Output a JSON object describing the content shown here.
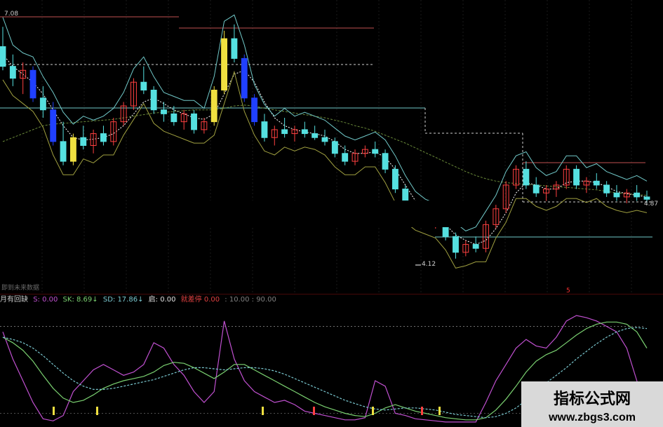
{
  "chart_data": [
    {
      "type": "candlestick",
      "title": "",
      "price_labels": {
        "high": "7.08",
        "low": "4.12",
        "last": "4.87"
      },
      "ylim": [
        3.8,
        7.3
      ],
      "candles": [
        [
          6.8,
          7.05,
          6.5,
          6.55
        ],
        [
          6.55,
          6.7,
          6.3,
          6.4
        ],
        [
          6.4,
          6.6,
          6.2,
          6.5
        ],
        [
          6.5,
          6.55,
          6.1,
          6.15
        ],
        [
          6.15,
          6.3,
          5.9,
          6.0
        ],
        [
          6.0,
          6.1,
          5.55,
          5.6
        ],
        [
          5.6,
          5.85,
          5.3,
          5.35
        ],
        [
          5.35,
          5.7,
          5.3,
          5.65
        ],
        [
          5.65,
          5.8,
          5.5,
          5.55
        ],
        [
          5.55,
          5.75,
          5.45,
          5.7
        ],
        [
          5.7,
          5.8,
          5.55,
          5.6
        ],
        [
          5.6,
          5.9,
          5.55,
          5.85
        ],
        [
          5.85,
          6.1,
          5.8,
          6.05
        ],
        [
          6.05,
          6.4,
          6.0,
          6.35
        ],
        [
          6.35,
          6.55,
          6.2,
          6.25
        ],
        [
          6.25,
          6.3,
          5.95,
          6.0
        ],
        [
          6.0,
          6.1,
          5.85,
          5.95
        ],
        [
          5.95,
          6.05,
          5.8,
          5.85
        ],
        [
          5.85,
          6.0,
          5.75,
          5.95
        ],
        [
          5.95,
          6.0,
          5.7,
          5.75
        ],
        [
          5.75,
          5.9,
          5.7,
          5.85
        ],
        [
          5.85,
          6.3,
          5.8,
          6.25
        ],
        [
          6.25,
          7.0,
          6.2,
          6.9
        ],
        [
          6.9,
          7.08,
          6.6,
          6.65
        ],
        [
          6.65,
          6.7,
          6.1,
          6.15
        ],
        [
          6.15,
          6.2,
          5.8,
          5.85
        ],
        [
          5.85,
          5.95,
          5.6,
          5.65
        ],
        [
          5.65,
          5.8,
          5.55,
          5.75
        ],
        [
          5.75,
          5.9,
          5.65,
          5.7
        ],
        [
          5.7,
          5.8,
          5.6,
          5.75
        ],
        [
          5.75,
          5.85,
          5.65,
          5.7
        ],
        [
          5.7,
          5.8,
          5.62,
          5.65
        ],
        [
          5.65,
          5.75,
          5.55,
          5.6
        ],
        [
          5.6,
          5.65,
          5.4,
          5.45
        ],
        [
          5.45,
          5.55,
          5.3,
          5.35
        ],
        [
          5.35,
          5.5,
          5.3,
          5.45
        ],
        [
          5.45,
          5.55,
          5.4,
          5.5
        ],
        [
          5.5,
          5.6,
          5.4,
          5.45
        ],
        [
          5.45,
          5.5,
          5.2,
          5.25
        ],
        [
          5.25,
          5.3,
          4.95,
          5.0
        ],
        [
          5.0,
          5.05,
          4.7,
          4.75
        ],
        [
          4.75,
          4.85,
          4.6,
          4.65
        ],
        [
          4.65,
          4.75,
          4.55,
          4.6
        ],
        [
          4.6,
          4.7,
          4.5,
          4.65
        ],
        [
          4.65,
          4.7,
          4.35,
          4.4
        ],
        [
          4.4,
          4.45,
          4.12,
          4.2
        ],
        [
          4.2,
          4.35,
          4.15,
          4.3
        ],
        [
          4.3,
          4.4,
          4.2,
          4.25
        ],
        [
          4.25,
          4.6,
          4.2,
          4.55
        ],
        [
          4.55,
          4.8,
          4.5,
          4.75
        ],
        [
          4.75,
          5.1,
          4.7,
          5.05
        ],
        [
          5.05,
          5.3,
          5.0,
          5.25
        ],
        [
          5.25,
          5.35,
          5.0,
          5.05
        ],
        [
          5.05,
          5.15,
          4.9,
          4.95
        ],
        [
          4.95,
          5.05,
          4.85,
          5.0
        ],
        [
          5.0,
          5.1,
          4.9,
          5.05
        ],
        [
          5.05,
          5.3,
          5.0,
          5.25
        ],
        [
          5.25,
          5.3,
          5.0,
          5.05
        ],
        [
          5.05,
          5.15,
          4.95,
          5.1
        ],
        [
          5.1,
          5.2,
          5.0,
          5.05
        ],
        [
          5.05,
          5.1,
          4.9,
          4.95
        ],
        [
          4.95,
          5.05,
          4.85,
          4.9
        ],
        [
          4.9,
          5.0,
          4.82,
          4.95
        ],
        [
          4.95,
          5.05,
          4.85,
          4.9
        ],
        [
          4.9,
          4.98,
          4.82,
          4.87
        ]
      ],
      "ma_fast": [
        6.7,
        6.55,
        6.45,
        6.35,
        6.2,
        6.0,
        5.8,
        5.65,
        5.62,
        5.63,
        5.65,
        5.7,
        5.8,
        5.95,
        6.1,
        6.15,
        6.08,
        6.0,
        5.95,
        5.9,
        5.88,
        5.95,
        6.2,
        6.45,
        6.5,
        6.35,
        6.1,
        5.9,
        5.8,
        5.75,
        5.72,
        5.7,
        5.67,
        5.6,
        5.5,
        5.45,
        5.45,
        5.47,
        5.4,
        5.25,
        5.05,
        4.85,
        4.72,
        4.65,
        4.55,
        4.42,
        4.35,
        4.3,
        4.35,
        4.5,
        4.7,
        4.95,
        5.08,
        5.05,
        5.0,
        5.0,
        5.08,
        5.1,
        5.1,
        5.08,
        5.03,
        4.97,
        4.94,
        4.92,
        4.9
      ],
      "ma_slow": [
        5.6,
        5.65,
        5.7,
        5.75,
        5.8,
        5.82,
        5.83,
        5.84,
        5.85,
        5.86,
        5.87,
        5.88,
        5.9,
        5.92,
        5.94,
        5.96,
        5.97,
        5.98,
        5.99,
        6.0,
        6.0,
        6.0,
        6.02,
        6.05,
        6.06,
        6.05,
        6.02,
        6.0,
        5.98,
        5.96,
        5.94,
        5.92,
        5.9,
        5.87,
        5.84,
        5.8,
        5.77,
        5.73,
        5.68,
        5.63,
        5.58,
        5.52,
        5.46,
        5.4,
        5.34,
        5.28,
        5.22,
        5.17,
        5.13,
        5.1,
        5.08,
        5.07,
        5.06,
        5.05,
        5.04,
        5.03,
        5.02,
        5.01,
        5.0,
        4.99,
        4.97,
        4.95,
        4.94,
        4.93,
        4.92
      ]
    },
    {
      "type": "line",
      "title": "",
      "ylim": [
        0,
        100
      ],
      "series": [
        {
          "name": "S",
          "color": "#c050d0",
          "values": [
            85,
            60,
            40,
            20,
            5,
            3,
            8,
            30,
            40,
            50,
            55,
            50,
            45,
            48,
            55,
            75,
            70,
            55,
            45,
            30,
            20,
            30,
            95,
            60,
            40,
            30,
            25,
            20,
            22,
            18,
            12,
            10,
            8,
            6,
            4,
            4,
            6,
            40,
            35,
            10,
            8,
            5,
            4,
            3,
            2,
            2,
            2,
            2,
            20,
            40,
            55,
            70,
            78,
            72,
            70,
            80,
            95,
            100,
            98,
            95,
            90,
            85,
            70,
            40,
            10
          ]
        },
        {
          "name": "SK",
          "color": "#7ad070",
          "values": [
            80,
            75,
            68,
            58,
            45,
            33,
            24,
            20,
            22,
            27,
            33,
            37,
            40,
            42,
            44,
            48,
            54,
            57,
            56,
            52,
            47,
            42,
            48,
            55,
            55,
            50,
            45,
            40,
            35,
            30,
            25,
            20,
            16,
            13,
            10,
            8,
            7,
            10,
            15,
            18,
            15,
            12,
            10,
            8,
            6,
            5,
            4,
            4,
            6,
            13,
            23,
            35,
            48,
            58,
            64,
            68,
            75,
            82,
            88,
            92,
            94,
            94,
            92,
            85,
            70
          ]
        },
        {
          "name": "SD",
          "color": "#7ac8d0",
          "values": [
            80,
            78,
            75,
            70,
            63,
            55,
            47,
            40,
            35,
            32,
            32,
            33,
            35,
            37,
            39,
            41,
            44,
            47,
            50,
            52,
            52,
            51,
            50,
            51,
            52,
            52,
            51,
            49,
            46,
            42,
            38,
            34,
            30,
            26,
            22,
            19,
            16,
            14,
            13,
            14,
            15,
            15,
            14,
            13,
            11,
            9,
            8,
            7,
            6,
            7,
            10,
            15,
            22,
            30,
            38,
            45,
            52,
            60,
            67,
            74,
            80,
            85,
            88,
            89,
            88
          ]
        }
      ],
      "info_labels": [
        {
          "text": "月有回缺",
          "color": "#c8c8c8"
        },
        {
          "text": "S: 0.00",
          "color": "#c050d0"
        },
        {
          "text": "SK: 8.69↓",
          "color": "#7ad070"
        },
        {
          "text": "SD: 17.86↓",
          "color": "#7ac8d0"
        },
        {
          "text": "启: 0.00",
          "color": "#e0e0e0"
        },
        {
          "text": "就差停 0.00",
          "color": "#e04040"
        },
        {
          "text": ": 10.00 : 90.00",
          "color": "#808080"
        }
      ],
      "subtitle": "即到未来数据"
    }
  ],
  "watermark": {
    "title": "指标公式网",
    "url": "www.zbgs3.com"
  },
  "colors": {
    "up": "#ff4040",
    "down_cyan": "#55e0e0",
    "yellow": "#f0e040",
    "blue": "#2040ff"
  }
}
